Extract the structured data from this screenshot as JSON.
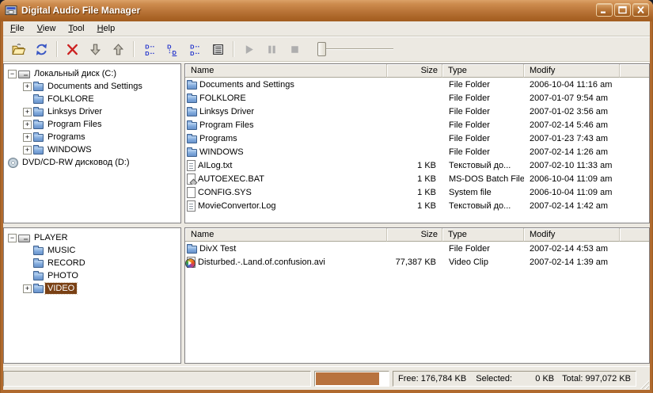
{
  "window": {
    "title": "Digital Audio File Manager"
  },
  "menu": {
    "items": [
      "File",
      "View",
      "Tool",
      "Help"
    ]
  },
  "toolbar": {
    "buttons": [
      "open-folder",
      "refresh",
      "delete",
      "move-down",
      "move-up",
      "collapse-tree",
      "expand-branch",
      "collapse-branch",
      "details-view",
      "play",
      "pause",
      "stop"
    ],
    "slider_position": 0
  },
  "disk_tree": {
    "rows": [
      {
        "indent": 0,
        "expander": "minus",
        "icon": "drive",
        "label": "Локальный диск (C:)"
      },
      {
        "indent": 1,
        "expander": "plus",
        "icon": "folder",
        "label": "Documents and Settings"
      },
      {
        "indent": 1,
        "expander": "none",
        "icon": "folder",
        "label": "FOLKLORE"
      },
      {
        "indent": 1,
        "expander": "plus",
        "icon": "folder",
        "label": "Linksys Driver"
      },
      {
        "indent": 1,
        "expander": "plus",
        "icon": "folder",
        "label": "Program Files"
      },
      {
        "indent": 1,
        "expander": "plus",
        "icon": "folder",
        "label": "Programs"
      },
      {
        "indent": 1,
        "expander": "plus",
        "icon": "folder",
        "label": "WINDOWS"
      },
      {
        "indent": 0,
        "expander": null,
        "icon": "cd",
        "label": "DVD/CD-RW дисковод (D:)"
      }
    ]
  },
  "player_tree": {
    "rows": [
      {
        "indent": 0,
        "expander": "minus",
        "icon": "drive",
        "label": "PLAYER"
      },
      {
        "indent": 1,
        "expander": "none",
        "icon": "folder",
        "label": "MUSIC"
      },
      {
        "indent": 1,
        "expander": "none",
        "icon": "folder",
        "label": "RECORD"
      },
      {
        "indent": 1,
        "expander": "none",
        "icon": "folder",
        "label": "PHOTO"
      },
      {
        "indent": 1,
        "expander": "plus",
        "icon": "folder",
        "label": "VIDEO",
        "selected": true
      }
    ]
  },
  "columns": {
    "name": "Name",
    "size": "Size",
    "type": "Type",
    "modify": "Modify"
  },
  "top_list": {
    "rows": [
      {
        "icon": "folder",
        "name": "Documents and Settings",
        "size": "",
        "type": "File Folder",
        "modify": "2006-10-04 11:16 am"
      },
      {
        "icon": "folder",
        "name": "FOLKLORE",
        "size": "",
        "type": "File Folder",
        "modify": "2007-01-07 9:54 am"
      },
      {
        "icon": "folder",
        "name": "Linksys Driver",
        "size": "",
        "type": "File Folder",
        "modify": "2007-01-02 3:56 am"
      },
      {
        "icon": "folder",
        "name": "Program Files",
        "size": "",
        "type": "File Folder",
        "modify": "2007-02-14 5:46 am"
      },
      {
        "icon": "folder",
        "name": "Programs",
        "size": "",
        "type": "File Folder",
        "modify": "2007-01-23 7:43 am"
      },
      {
        "icon": "folder",
        "name": "WINDOWS",
        "size": "",
        "type": "File Folder",
        "modify": "2007-02-14 1:26 am"
      },
      {
        "icon": "text-file",
        "name": "AILog.txt",
        "size": "1 KB",
        "type": "Текстовый до...",
        "modify": "2007-02-10 11:33 am"
      },
      {
        "icon": "bat-file",
        "name": "AUTOEXEC.BAT",
        "size": "1 KB",
        "type": "MS-DOS Batch File",
        "modify": "2006-10-04 11:09 am"
      },
      {
        "icon": "sys-file",
        "name": "CONFIG.SYS",
        "size": "1 KB",
        "type": "System file",
        "modify": "2006-10-04 11:09 am"
      },
      {
        "icon": "text-file",
        "name": "MovieConvertor.Log",
        "size": "1 KB",
        "type": "Текстовый до...",
        "modify": "2007-02-14 1:42 am"
      }
    ]
  },
  "bottom_list": {
    "rows": [
      {
        "icon": "folder",
        "name": "DivX Test",
        "size": "",
        "type": "File Folder",
        "modify": "2007-02-14 4:53 am"
      },
      {
        "icon": "video-file",
        "name": "Disturbed.-.Land.of.confusion.avi",
        "size": "77,387 KB",
        "type": "Video Clip",
        "modify": "2007-02-14 1:39 am"
      }
    ]
  },
  "status": {
    "free": "Free: 176,784 KB",
    "selected_label": "Selected:",
    "selected_value": "0 KB",
    "total": "Total: 997,072 KB",
    "progress_percent": 88
  }
}
